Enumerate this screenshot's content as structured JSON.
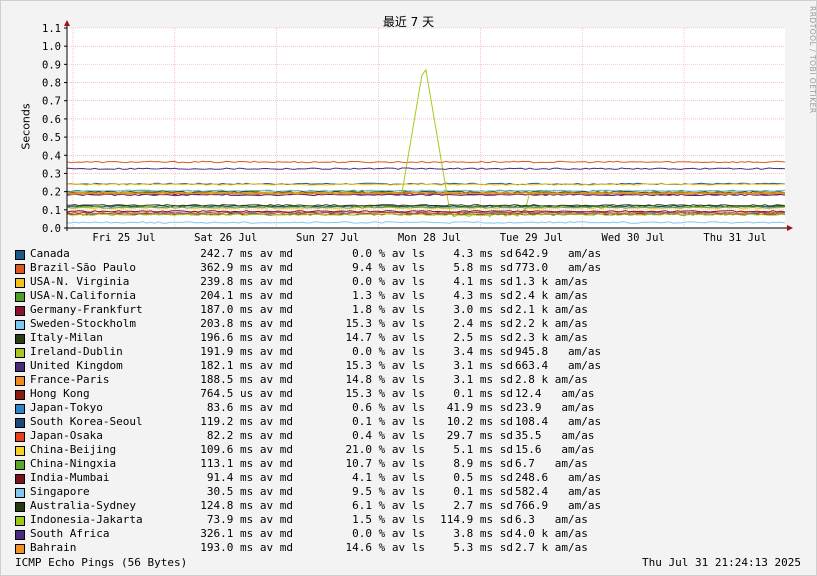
{
  "title": "最近 7 天",
  "watermark": "RRDTOOL / TOBI OETIKER",
  "chart_data": {
    "type": "line",
    "ylabel": "Seconds",
    "ylim": [
      0,
      1.1
    ],
    "yticks": [
      "0.0",
      "0.1",
      "0.2",
      "0.3",
      "0.4",
      "0.5",
      "0.6",
      "0.7",
      "0.8",
      "0.9",
      "1.0",
      "1.1"
    ],
    "xticks": [
      "Fri 25 Jul",
      "Sat 26 Jul",
      "Sun 27 Jul",
      "Mon 28 Jul",
      "Tue 29 Jul",
      "Wed 30 Jul",
      "Thu 31 Jul"
    ],
    "grid": true,
    "series": [
      {
        "name": "Canada",
        "color": "#1a5a8a",
        "avg_s": 0.2427
      },
      {
        "name": "Brazil-São Paulo",
        "color": "#e0561f",
        "avg_s": 0.3629
      },
      {
        "name": "USA-N. Virginia",
        "color": "#f2c21a",
        "avg_s": 0.2398
      },
      {
        "name": "USA-N.California",
        "color": "#4f9e2a",
        "avg_s": 0.2041
      },
      {
        "name": "Germany-Frankfurt",
        "color": "#8a1230",
        "avg_s": 0.187
      },
      {
        "name": "Sweden-Stockholm",
        "color": "#7cc8f0",
        "avg_s": 0.2038
      },
      {
        "name": "Italy-Milan",
        "color": "#2b3d16",
        "avg_s": 0.1966
      },
      {
        "name": "Ireland-Dublin",
        "color": "#a8c820",
        "avg_s": 0.1919
      },
      {
        "name": "United Kingdom",
        "color": "#4a2a7a",
        "avg_s": 0.1821
      },
      {
        "name": "France-Paris",
        "color": "#f08a1a",
        "avg_s": 0.1885
      },
      {
        "name": "Hong Kong",
        "color": "#8a1a12",
        "avg_s": 0.0007645
      },
      {
        "name": "Japan-Tokyo",
        "color": "#2a86c8",
        "avg_s": 0.0836
      },
      {
        "name": "South Korea-Seoul",
        "color": "#1a4a7a",
        "avg_s": 0.1192
      },
      {
        "name": "Japan-Osaka",
        "color": "#e8401a",
        "avg_s": 0.0822
      },
      {
        "name": "China-Beijing",
        "color": "#f8d020",
        "avg_s": 0.1096
      },
      {
        "name": "China-Ningxia",
        "color": "#5aa82a",
        "avg_s": 0.1131
      },
      {
        "name": "India-Mumbai",
        "color": "#7a1020",
        "avg_s": 0.0914
      },
      {
        "name": "Singapore",
        "color": "#80c8f0",
        "avg_s": 0.0305
      },
      {
        "name": "Australia-Sydney",
        "color": "#2a3a10",
        "avg_s": 0.1248
      },
      {
        "name": "Indonesia-Jakarta",
        "color": "#a0c818",
        "avg_s": 0.0739
      },
      {
        "name": "South Africa",
        "color": "#4a2a80",
        "avg_s": 0.3261
      },
      {
        "name": "Bahrain",
        "color": "#f09020",
        "avg_s": 0.193
      }
    ],
    "spike": {
      "series": "Ireland-Dublin",
      "date": "Mon 28 Jul",
      "peak_s": 0.92
    }
  },
  "legend": [
    {
      "name": "Canada",
      "avg": "242.7 ms av md",
      "loss": "0.0 % av ls",
      "sd": "4.3 ms sd",
      "amas": "642.9   am/as"
    },
    {
      "name": "Brazil-São Paulo",
      "avg": "362.9 ms av md",
      "loss": "9.4 % av ls",
      "sd": "5.8 ms sd",
      "amas": "773.0   am/as"
    },
    {
      "name": "USA-N. Virginia",
      "avg": "239.8 ms av md",
      "loss": "0.0 % av ls",
      "sd": "4.1 ms sd",
      "amas": "1.3 k am/as"
    },
    {
      "name": "USA-N.California",
      "avg": "204.1 ms av md",
      "loss": "1.3 % av ls",
      "sd": "4.3 ms sd",
      "amas": "2.4 k am/as"
    },
    {
      "name": "Germany-Frankfurt",
      "avg": "187.0 ms av md",
      "loss": "1.8 % av ls",
      "sd": "3.0 ms sd",
      "amas": "2.1 k am/as"
    },
    {
      "name": "Sweden-Stockholm",
      "avg": "203.8 ms av md",
      "loss": "15.3 % av ls",
      "sd": "2.4 ms sd",
      "amas": "2.2 k am/as"
    },
    {
      "name": "Italy-Milan",
      "avg": "196.6 ms av md",
      "loss": "14.7 % av ls",
      "sd": "2.5 ms sd",
      "amas": "2.3 k am/as"
    },
    {
      "name": "Ireland-Dublin",
      "avg": "191.9 ms av md",
      "loss": "0.0 % av ls",
      "sd": "3.4 ms sd",
      "amas": "945.8   am/as"
    },
    {
      "name": "United Kingdom",
      "avg": "182.1 ms av md",
      "loss": "15.3 % av ls",
      "sd": "3.1 ms sd",
      "amas": "663.4   am/as"
    },
    {
      "name": "France-Paris",
      "avg": "188.5 ms av md",
      "loss": "14.8 % av ls",
      "sd": "3.1 ms sd",
      "amas": "2.8 k am/as"
    },
    {
      "name": "Hong Kong",
      "avg": "764.5 us av md",
      "loss": "15.3 % av ls",
      "sd": "0.1 ms sd",
      "amas": "12.4   am/as"
    },
    {
      "name": "Japan-Tokyo",
      "avg": "83.6 ms av md",
      "loss": "0.6 % av ls",
      "sd": "41.9 ms sd",
      "amas": "23.9   am/as"
    },
    {
      "name": "South Korea-Seoul",
      "avg": "119.2 ms av md",
      "loss": "0.1 % av ls",
      "sd": "10.2 ms sd",
      "amas": "108.4   am/as"
    },
    {
      "name": "Japan-Osaka",
      "avg": "82.2 ms av md",
      "loss": "0.4 % av ls",
      "sd": "29.7 ms sd",
      "amas": "35.5   am/as"
    },
    {
      "name": "China-Beijing",
      "avg": "109.6 ms av md",
      "loss": "21.0 % av ls",
      "sd": "5.1 ms sd",
      "amas": "15.6   am/as"
    },
    {
      "name": "China-Ningxia",
      "avg": "113.1 ms av md",
      "loss": "10.7 % av ls",
      "sd": "8.9 ms sd",
      "amas": "6.7   am/as"
    },
    {
      "name": "India-Mumbai",
      "avg": "91.4 ms av md",
      "loss": "4.1 % av ls",
      "sd": "0.5 ms sd",
      "amas": "248.6   am/as"
    },
    {
      "name": "Singapore",
      "avg": "30.5 ms av md",
      "loss": "9.5 % av ls",
      "sd": "0.1 ms sd",
      "amas": "582.4   am/as"
    },
    {
      "name": "Australia-Sydney",
      "avg": "124.8 ms av md",
      "loss": "6.1 % av ls",
      "sd": "2.7 ms sd",
      "amas": "766.9   am/as"
    },
    {
      "name": "Indonesia-Jakarta",
      "avg": "73.9 ms av md",
      "loss": "1.5 % av ls",
      "sd": "114.9 ms sd",
      "amas": "6.3   am/as"
    },
    {
      "name": "South Africa",
      "avg": "326.1 ms av md",
      "loss": "0.0 % av ls",
      "sd": "3.8 ms sd",
      "amas": "4.0 k am/as"
    },
    {
      "name": "Bahrain",
      "avg": "193.0 ms av md",
      "loss": "14.6 % av ls",
      "sd": "5.3 ms sd",
      "amas": "2.7 k am/as"
    }
  ],
  "footer": {
    "left": "ICMP Echo Pings (56 Bytes)",
    "right": "Thu Jul 31 21:24:13 2025"
  }
}
